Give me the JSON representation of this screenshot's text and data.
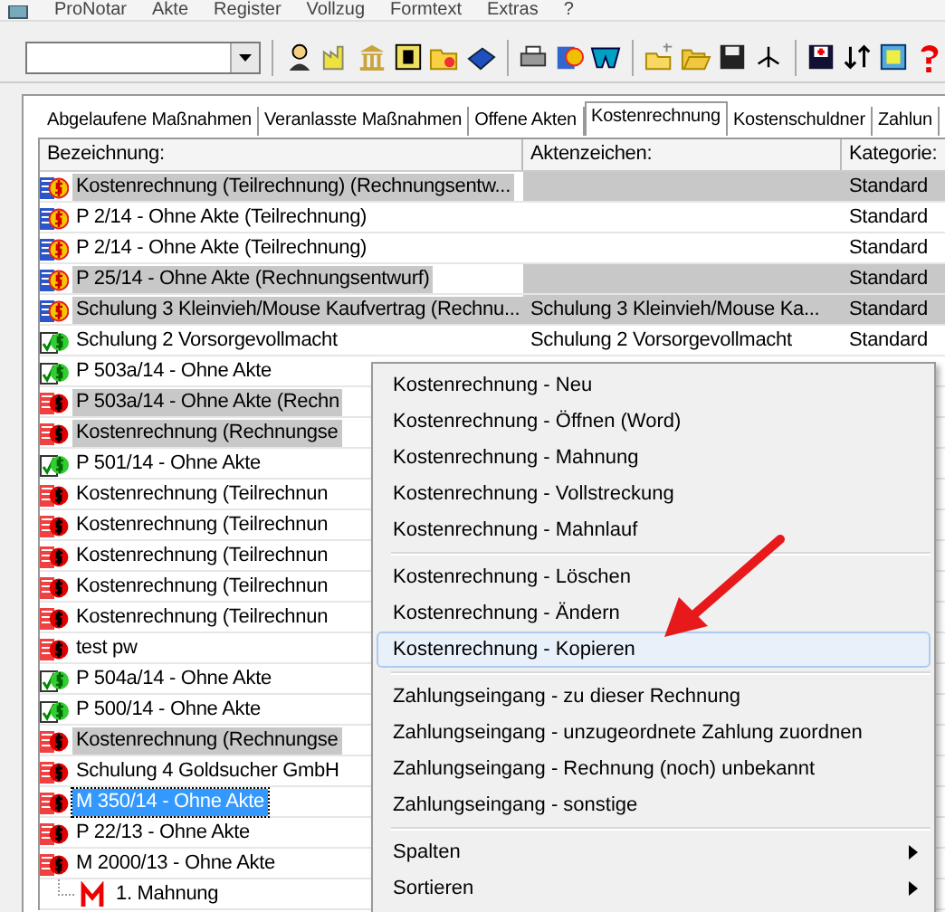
{
  "menu_bar": [
    "ProNotar",
    "Akte",
    "Register",
    "Vollzug",
    "Formtext",
    "Extras",
    "?"
  ],
  "tabs": [
    {
      "label": "Abgelaufene Maßnahmen",
      "selected": false
    },
    {
      "label": "Veranlasste Maßnahmen",
      "selected": false
    },
    {
      "label": "Offene Akten",
      "selected": false
    },
    {
      "label": "Kostenrechnung",
      "selected": true
    },
    {
      "label": "Kostenschuldner",
      "selected": false
    },
    {
      "label": "Zahlun",
      "selected": false
    }
  ],
  "table": {
    "columns": [
      "Bezeichnung:",
      "Aktenzeichen:",
      "Kategorie:"
    ],
    "rows": [
      {
        "kind": "draft",
        "name": "Kostenrechnung (Teilrechnung) (Rechnungsentw...",
        "file": "",
        "category": "Standard",
        "shaded": true,
        "selected": false
      },
      {
        "kind": "draft",
        "name": "P 2/14 - Ohne Akte (Teilrechnung)",
        "file": "",
        "category": "Standard",
        "shaded": false,
        "selected": false
      },
      {
        "kind": "draft",
        "name": "P 2/14 - Ohne Akte (Teilrechnung)",
        "file": "",
        "category": "Standard",
        "shaded": false,
        "selected": false
      },
      {
        "kind": "draft",
        "name": "P 25/14 - Ohne Akte (Rechnungsentwurf)",
        "file": "",
        "category": "Standard",
        "shaded": true,
        "selected": false
      },
      {
        "kind": "draft",
        "name": "Schulung 3 Kleinvieh/Mouse Kaufvertrag (Rechnu...",
        "file": "Schulung 3 Kleinvieh/Mouse Ka...",
        "category": "Standard",
        "shaded": true,
        "selected": false
      },
      {
        "kind": "paid",
        "name": "Schulung 2 Vorsorgevollmacht",
        "file": "Schulung 2 Vorsorgevollmacht",
        "category": "Standard",
        "shaded": false,
        "selected": false
      },
      {
        "kind": "paid",
        "name": "P 503a/14 - Ohne Akte",
        "shaded": false,
        "selected": false
      },
      {
        "kind": "open",
        "name": "P 503a/14 - Ohne Akte (Rechn",
        "shaded": true,
        "selected": false
      },
      {
        "kind": "open",
        "name": "Kostenrechnung (Rechnungse",
        "shaded": true,
        "selected": false
      },
      {
        "kind": "paid",
        "name": "P 501/14 - Ohne Akte",
        "shaded": false,
        "selected": false
      },
      {
        "kind": "open",
        "name": "Kostenrechnung (Teilrechnun",
        "shaded": false,
        "selected": false
      },
      {
        "kind": "open",
        "name": "Kostenrechnung (Teilrechnun",
        "shaded": false,
        "selected": false
      },
      {
        "kind": "open",
        "name": "Kostenrechnung (Teilrechnun",
        "shaded": false,
        "selected": false
      },
      {
        "kind": "open",
        "name": "Kostenrechnung (Teilrechnun",
        "shaded": false,
        "selected": false
      },
      {
        "kind": "open",
        "name": "Kostenrechnung (Teilrechnun",
        "shaded": false,
        "selected": false
      },
      {
        "kind": "open",
        "name": "test pw",
        "shaded": false,
        "selected": false
      },
      {
        "kind": "paid",
        "name": "P 504a/14 - Ohne Akte",
        "shaded": false,
        "selected": false
      },
      {
        "kind": "paid",
        "name": "P 500/14 - Ohne Akte",
        "shaded": false,
        "selected": false
      },
      {
        "kind": "open",
        "name": "Kostenrechnung (Rechnungse",
        "shaded": true,
        "selected": false
      },
      {
        "kind": "open",
        "name": "Schulung 4 Goldsucher GmbH",
        "shaded": false,
        "selected": false
      },
      {
        "kind": "open",
        "name": "M 350/14 - Ohne Akte",
        "shaded": false,
        "selected": true
      },
      {
        "kind": "open",
        "name": "P 22/13 - Ohne Akte",
        "shaded": false,
        "selected": false
      },
      {
        "kind": "open",
        "name": "M 2000/13 - Ohne Akte",
        "shaded": false,
        "selected": false,
        "children": [
          {
            "kind": "reminder",
            "name": "1. Mahnung"
          }
        ]
      }
    ]
  },
  "context_menu": {
    "groups": [
      [
        {
          "label": "Kostenrechnung - Neu",
          "selected": false,
          "submenu": false
        },
        {
          "label": "Kostenrechnung - Öffnen (Word)",
          "selected": false,
          "submenu": false
        },
        {
          "label": "Kostenrechnung - Mahnung",
          "selected": false,
          "submenu": false
        },
        {
          "label": "Kostenrechnung - Vollstreckung",
          "selected": false,
          "submenu": false
        },
        {
          "label": "Kostenrechnung - Mahnlauf",
          "selected": false,
          "submenu": false
        }
      ],
      [
        {
          "label": "Kostenrechnung - Löschen",
          "selected": false,
          "submenu": false
        },
        {
          "label": "Kostenrechnung - Ändern",
          "selected": false,
          "submenu": false
        },
        {
          "label": "Kostenrechnung - Kopieren",
          "selected": true,
          "submenu": false
        }
      ],
      [
        {
          "label": "Zahlungseingang - zu dieser Rechnung",
          "selected": false,
          "submenu": false
        },
        {
          "label": "Zahlungseingang - unzugeordnete Zahlung zuordnen",
          "selected": false,
          "submenu": false
        },
        {
          "label": "Zahlungseingang - Rechnung (noch) unbekannt",
          "selected": false,
          "submenu": false
        },
        {
          "label": "Zahlungseingang - sonstige",
          "selected": false,
          "submenu": false
        }
      ],
      [
        {
          "label": "Spalten",
          "selected": false,
          "submenu": true
        },
        {
          "label": "Sortieren",
          "selected": false,
          "submenu": true
        }
      ]
    ]
  }
}
